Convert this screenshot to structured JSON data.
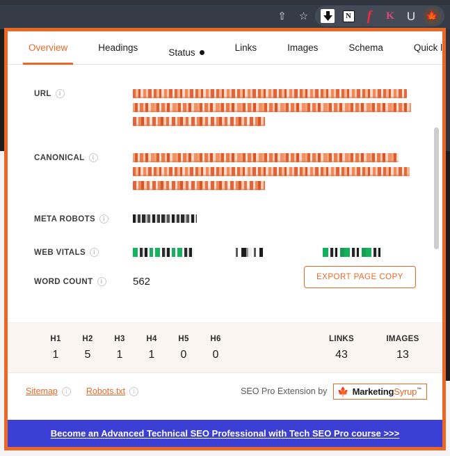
{
  "browser": {
    "toolbar_icons": [
      {
        "name": "share-icon",
        "glyph": "⇧"
      },
      {
        "name": "bookmark-star-icon",
        "glyph": "☆"
      }
    ],
    "extension_icons": [
      {
        "name": "download-arrow-icon",
        "glyph": "⬇"
      },
      {
        "name": "notion-icon",
        "glyph": "N"
      },
      {
        "name": "flash-icon",
        "glyph": "f"
      },
      {
        "name": "keywords-everywhere-icon",
        "glyph": "K"
      },
      {
        "name": "u-extension-icon",
        "glyph": "U"
      },
      {
        "name": "marketing-syrup-leaf-icon",
        "glyph": "🍁"
      }
    ]
  },
  "tabs": [
    {
      "label": "Overview",
      "active": true,
      "dot": false
    },
    {
      "label": "Headings",
      "active": false,
      "dot": false
    },
    {
      "label": "Status",
      "active": false,
      "dot": true
    },
    {
      "label": "Links",
      "active": false,
      "dot": false
    },
    {
      "label": "Images",
      "active": false,
      "dot": false
    },
    {
      "label": "Schema",
      "active": false,
      "dot": false
    },
    {
      "label": "Quick links",
      "active": false,
      "dot": false
    }
  ],
  "overview": {
    "url": {
      "label": "URL",
      "info": "i",
      "value": "[redacted url — pixelated, 3 lines]"
    },
    "canonical": {
      "label": "CANONICAL",
      "info": "i",
      "value": "[redacted canonical url — pixelated, 3 lines]"
    },
    "meta_robots": {
      "label": "META ROBOTS",
      "info": "i",
      "value": "[redacted meta robots value — pixelated]"
    },
    "web_vitals": {
      "label": "WEB VITALS",
      "info": "i",
      "values": [
        "[redacted vital 1 — pass]",
        "[redacted vital 2]",
        "[redacted vital 3 — pass]"
      ]
    },
    "word_count": {
      "label": "WORD COUNT",
      "info": "i",
      "value": "562"
    },
    "export_button": "EXPORT PAGE COPY"
  },
  "stats": {
    "headings": [
      {
        "key": "H1",
        "value": "1"
      },
      {
        "key": "H2",
        "value": "5"
      },
      {
        "key": "H3",
        "value": "1"
      },
      {
        "key": "H4",
        "value": "1"
      },
      {
        "key": "H5",
        "value": "0"
      },
      {
        "key": "H6",
        "value": "0"
      }
    ],
    "links": {
      "key": "LINKS",
      "value": "43"
    },
    "images": {
      "key": "IMAGES",
      "value": "13"
    }
  },
  "footer": {
    "sitemap_link": "Sitemap",
    "sitemap_info": "i",
    "robots_link": "Robots.txt",
    "robots_info": "i",
    "byline": "SEO Pro Extension by",
    "brand_leaf": "🍁",
    "brand_first": "Marketing",
    "brand_second": "Syrup",
    "brand_tm": "™"
  },
  "banner": {
    "text": "Become an Advanced Technical SEO Professional with Tech SEO Pro course >>>"
  },
  "colors": {
    "accent": "#ec6726",
    "banner_bg": "#3b3fd4",
    "chrome_bg": "#363c47",
    "stats_bg": "#fbf5f2"
  }
}
